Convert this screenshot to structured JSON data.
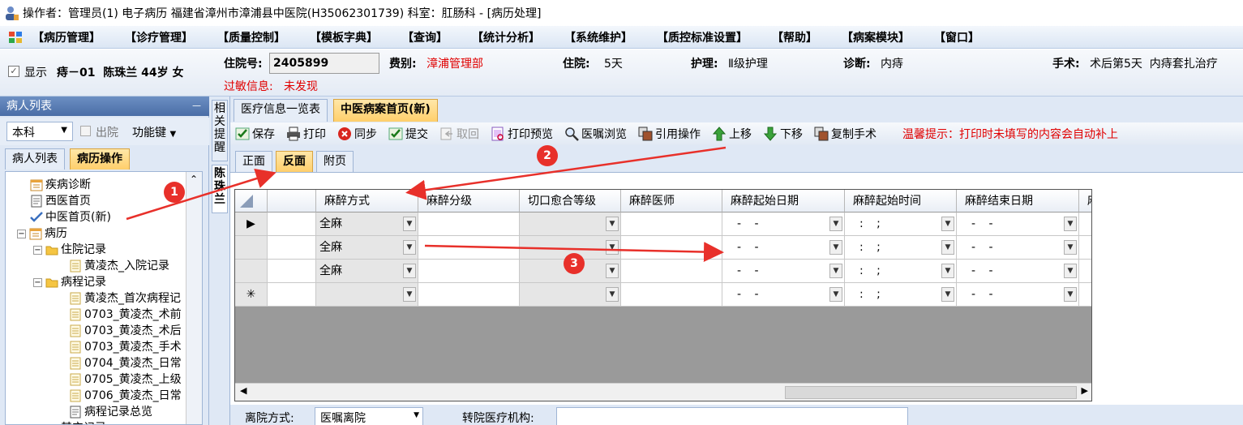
{
  "titlebar": {
    "text": "操作者：管理员(1) 电子病历  福建省漳州市漳浦县中医院(H35062301739)  科室：肛肠科 - [病历处理]"
  },
  "menu": [
    "【病历管理】",
    "【诊疗管理】",
    "【质量控制】",
    "【模板字典】",
    "【查询】",
    "【统计分析】",
    "【系统维护】",
    "【质控标准设置】",
    "【帮助】",
    "【病案模块】",
    "【窗口】"
  ],
  "patient": {
    "show_checkbox_label": "显示",
    "summary": "痔－01  陈珠兰 44岁 女",
    "admission_no_label": "住院号:",
    "admission_no": "2405899",
    "fee_label": "费别:",
    "fee": "漳浦管理部",
    "stay_label": "住院:",
    "stay": "5天",
    "nursing_label": "护理:",
    "nursing": "Ⅱ级护理",
    "diagnosis_label": "诊断:",
    "diagnosis": "内痔",
    "surgery_label": "手术:",
    "surgery": "术后第5天  内痔套扎治疗",
    "allergy_label": "过敏信息:",
    "allergy": "未发现"
  },
  "left_panel": {
    "title": "病人列表",
    "pin": "ᅳ",
    "dept_select": "本科",
    "discharged_label": "出院",
    "function_key_label": "功能键",
    "tabs": [
      "病人列表",
      "病历操作"
    ],
    "active_tab": 1,
    "tree": [
      {
        "label": "疾病诊断",
        "level": 1,
        "icon": "calendar"
      },
      {
        "label": "西医首页",
        "level": 1,
        "icon": "doc"
      },
      {
        "label": "中医首页(新)",
        "level": 1,
        "icon": "check"
      },
      {
        "label": "病历",
        "level": 0,
        "icon": "calendar"
      },
      {
        "label": "住院记录",
        "level": 1,
        "icon": "folder"
      },
      {
        "label": "黄凌杰_入院记录",
        "level": 2,
        "icon": "note"
      },
      {
        "label": "病程记录",
        "level": 1,
        "icon": "folder"
      },
      {
        "label": "黄凌杰_首次病程记",
        "level": 2,
        "icon": "note"
      },
      {
        "label": "0703_黄凌杰_术前",
        "level": 2,
        "icon": "note"
      },
      {
        "label": "0703_黄凌杰_术后",
        "level": 2,
        "icon": "note"
      },
      {
        "label": "0703_黄凌杰_手术",
        "level": 2,
        "icon": "note"
      },
      {
        "label": "0704_黄凌杰_日常",
        "level": 2,
        "icon": "note"
      },
      {
        "label": "0705_黄凌杰_上级",
        "level": 2,
        "icon": "note"
      },
      {
        "label": "0706_黄凌杰_日常",
        "level": 2,
        "icon": "note"
      },
      {
        "label": "病程记录总览",
        "level": 2,
        "icon": "doc"
      },
      {
        "label": "其它记录",
        "level": 1,
        "icon": "folder"
      }
    ]
  },
  "side_tabs": {
    "reminder": "相关提醒",
    "patient": "陈珠兰"
  },
  "doc_tabs": [
    "医疗信息一览表",
    "中医病案首页(新)"
  ],
  "active_doc_tab": 1,
  "toolbar": {
    "buttons": [
      "保存",
      "打印",
      "同步",
      "提交",
      "取回",
      "打印预览",
      "医嘱浏览",
      "引用操作",
      "上移",
      "下移",
      "复制手术"
    ],
    "hint": "温馨提示：打印时未填写的内容会自动补上"
  },
  "page_tabs": [
    "正面",
    "反面",
    "附页"
  ],
  "active_page_tab": 1,
  "grid": {
    "columns": [
      "麻醉方式",
      "麻醉分级",
      "切口愈合等级",
      "麻醉医师",
      "麻醉起始日期",
      "麻醉起始时间",
      "麻醉结束日期",
      "麻"
    ],
    "rows": [
      {
        "marker": "▶",
        "anesthesia": "全麻",
        "date": "-  -",
        "time": ":  ;"
      },
      {
        "marker": "",
        "anesthesia": "全麻",
        "date": "-  -",
        "time": ":  ;"
      },
      {
        "marker": "",
        "anesthesia": "全麻",
        "date": "-  -",
        "time": ":  ;"
      },
      {
        "marker": "✳",
        "anesthesia": "",
        "date": "-  -",
        "time": ":  ;"
      }
    ]
  },
  "bottom": {
    "discharge_label": "离院方式:",
    "discharge_value": "医嘱离院",
    "transfer_label": "转院医疗机构:"
  },
  "annotations": [
    "1",
    "2",
    "3"
  ],
  "colors": {
    "accent_red": "#e00000",
    "tab_active": "#ffcf6b",
    "panel_blue": "#dfe8f5"
  }
}
